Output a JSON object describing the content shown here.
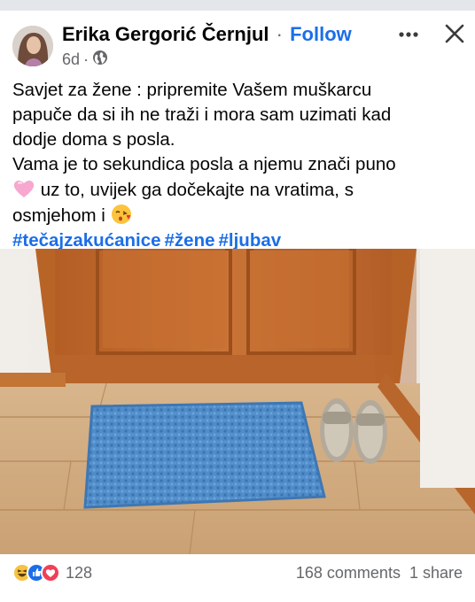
{
  "post": {
    "author": "Erika Gergorić Černjul",
    "separator": "·",
    "follow_label": "Follow",
    "timestamp": "6d",
    "meta_separator": "·",
    "audience_icon": "globe-icon",
    "more_icon": "more-options-icon",
    "close_icon": "close-icon",
    "text_lines": [
      "Savjet za žene : pripremite Vašem muškarcu",
      "papuče da si ih ne traži i mora sam uzimati kad",
      "dodje doma s posla.",
      "Vama je to sekundica posla a njemu znači puno",
      "uz to, uvijek ga dočekajte na vratima, s",
      "osmjehom i"
    ],
    "emojis": [
      "pink-heart-emoji",
      "kissing-face-emoji"
    ],
    "hashtags": [
      "#tečajzakućanice",
      "#žene",
      "#ljubav"
    ]
  },
  "photo": {
    "subject": "door-with-doormat-and-slippers"
  },
  "footer": {
    "reaction_icons": [
      "haha-reaction-icon",
      "like-reaction-icon",
      "love-reaction-icon"
    ],
    "reaction_count": "128",
    "comments": "168 comments",
    "shares": "1 share"
  },
  "colors": {
    "accent": "#1b6ee8",
    "secondary_text": "#65676b",
    "door": "#c26a2e",
    "mat": "#4f8cc9"
  }
}
